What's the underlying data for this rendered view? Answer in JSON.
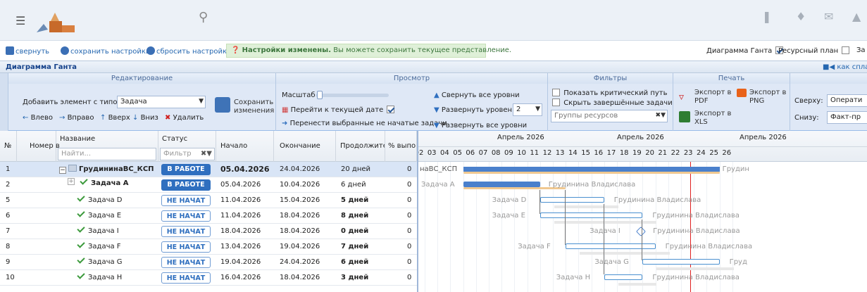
{
  "topbar": {
    "menu_icon": "menu-icon",
    "search_icon": "search-icon",
    "icons": [
      "bookmark-icon",
      "bell-icon",
      "mail-icon",
      "thumbs-up-icon"
    ]
  },
  "actions": {
    "collapse": "свернуть",
    "save_settings": "сохранить настройки",
    "reset_settings": "сбросить настройки",
    "notice_bold": "Настройки изменены.",
    "notice_rest": " Вы можете сохранить текущее представление.",
    "gantt_label": "Диаграмма Ганта",
    "gantt_checked": true,
    "resource_label": "Ресурсный план",
    "resource_checked": false,
    "cut": "За"
  },
  "gantt_bar": {
    "title": "Диаграмма Ганта",
    "right_link": "как спла"
  },
  "ribbon": {
    "edit": {
      "head": "Редактирование",
      "add_label": "Добавить элемент с типом",
      "type_value": "Задача",
      "left": "Влево",
      "right": "Вправо",
      "up": "Вверх",
      "down": "Вниз",
      "delete": "Удалить",
      "save_changes_1": "Сохранить",
      "save_changes_2": "изменения"
    },
    "view": {
      "head": "Просмотр",
      "scale": "Масштаб",
      "goto_today": "Перейти к текущей дате",
      "goto_today_checked": true,
      "move_selected": "Перенести выбранные не начатые задачи",
      "collapse_all": "Свернуть все уровни",
      "expand_level": "Развернуть уровень",
      "level_value": "2",
      "expand_all": "Развернуть все уровни"
    },
    "filters": {
      "head": "Фильтры",
      "critical": "Показать критический путь",
      "hide_done": "Скрыть завершённые задачи",
      "groups_placeholder": "Группы ресурсов"
    },
    "print": {
      "head": "Печать",
      "pdf_1": "Экспорт в",
      "pdf_2": "PDF",
      "png_1": "Экспорт в",
      "png_2": "PNG",
      "xls_1": "Экспорт в",
      "xls_2": "XLS"
    },
    "extra": {
      "top_label": "Сверху:",
      "top_value": "Операти",
      "bottom_label": "Снизу:",
      "bottom_value": "Факт-пр"
    }
  },
  "grid": {
    "headers": {
      "num": "№",
      "number": "Номер в",
      "name": "Название",
      "status": "Статус",
      "start": "Начало",
      "end": "Окончание",
      "duration": "Продолжитель",
      "percent": "% выпо"
    },
    "find_placeholder": "Найти...",
    "filter_placeholder": "Фильтр",
    "rows": [
      {
        "num": "1",
        "name": "ГрудининаВС_КСП",
        "status": "В РАБОТЕ",
        "status_type": "work",
        "start": "05.04.2026",
        "end": "24.04.2026",
        "duration": "20 дней",
        "pct": "0",
        "level": 0,
        "bold_start": true,
        "bold_dur": false,
        "selected": true,
        "folder": true
      },
      {
        "num": "2",
        "name": "Задача A",
        "status": "В РАБОТЕ",
        "status_type": "work",
        "start": "05.04.2026",
        "end": "10.04.2026",
        "duration": "6 дней",
        "pct": "0",
        "level": 1,
        "bold_start": false,
        "bold_dur": false,
        "selected": false,
        "folder": false,
        "expander": true
      },
      {
        "num": "5",
        "name": "Задача D",
        "status": "НЕ НАЧАТ",
        "status_type": "new",
        "start": "11.04.2026",
        "end": "15.04.2026",
        "duration": "5 дней",
        "pct": "0",
        "level": 2,
        "bold_dur": true
      },
      {
        "num": "6",
        "name": "Задача E",
        "status": "НЕ НАЧАТ",
        "status_type": "new",
        "start": "11.04.2026",
        "end": "18.04.2026",
        "duration": "8 дней",
        "pct": "0",
        "level": 2,
        "bold_dur": true
      },
      {
        "num": "7",
        "name": "Задача I",
        "status": "НЕ НАЧАТ",
        "status_type": "new",
        "start": "18.04.2026",
        "end": "18.04.2026",
        "duration": "0 дней",
        "pct": "0",
        "level": 2,
        "bold_dur": true
      },
      {
        "num": "8",
        "name": "Задача F",
        "status": "НЕ НАЧАТ",
        "status_type": "new",
        "start": "13.04.2026",
        "end": "19.04.2026",
        "duration": "7 дней",
        "pct": "0",
        "level": 2,
        "bold_dur": true
      },
      {
        "num": "9",
        "name": "Задача G",
        "status": "НЕ НАЧАТ",
        "status_type": "new",
        "start": "19.04.2026",
        "end": "24.04.2026",
        "duration": "6 дней",
        "pct": "0",
        "level": 2,
        "bold_dur": true
      },
      {
        "num": "10",
        "name": "Задача H",
        "status": "НЕ НАЧАТ",
        "status_type": "new",
        "start": "16.04.2026",
        "end": "18.04.2026",
        "duration": "3 дней",
        "pct": "0",
        "level": 2,
        "bold_dur": true
      }
    ]
  },
  "timeline": {
    "months": [
      "Апрель 2026",
      "Апрель 2026",
      "Апрель 2026"
    ],
    "days": [
      "02",
      "03",
      "04",
      "05",
      "06",
      "07",
      "08",
      "09",
      "10",
      "11",
      "12",
      "13",
      "14",
      "15",
      "16",
      "17",
      "18",
      "19",
      "20",
      "21",
      "22",
      "23",
      "24",
      "25",
      "26"
    ],
    "left_label": "наВС_КСП",
    "right_label": "Грудин",
    "resource": "Грудинина Владислава",
    "labels": {
      "a": "Задача A",
      "d": "Задача D",
      "e": "Задача E",
      "i": "Задача I",
      "f": "Задача F",
      "g": "Задача G",
      "h": "Задача H"
    },
    "right_g": "Груд"
  },
  "colors": {
    "accent": "#2f6fbf",
    "today": "#e02020",
    "bar_summary": "#4a80cc"
  }
}
